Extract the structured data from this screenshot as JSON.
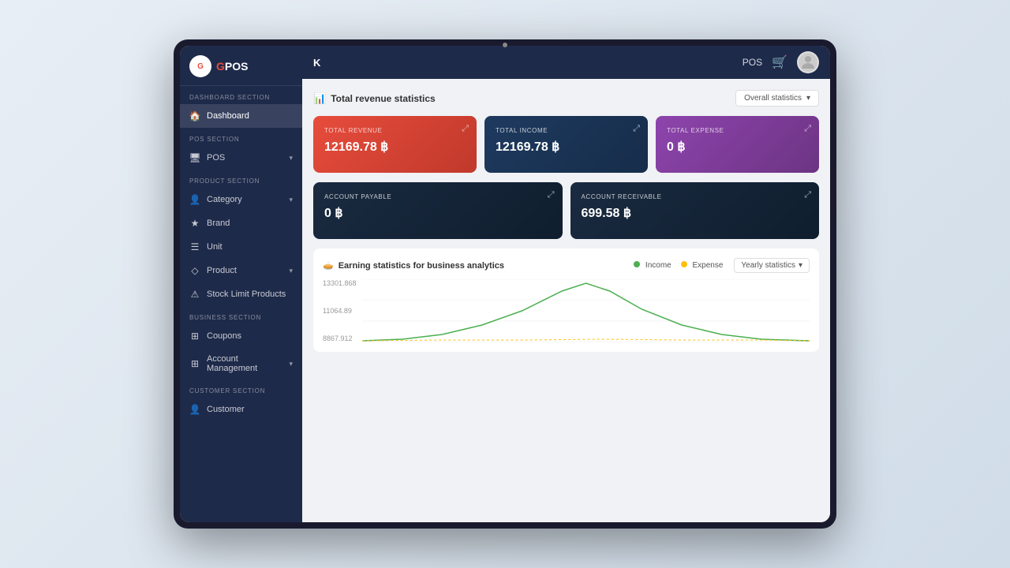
{
  "monitor": {
    "dot": ""
  },
  "sidebar": {
    "logo_text_prefix": "G",
    "logo_text_brand": "POS",
    "sections": [
      {
        "label": "DASHBOARD SECTION",
        "items": [
          {
            "id": "dashboard",
            "icon": "🏠",
            "label": "Dashboard",
            "active": true,
            "has_chevron": false
          }
        ]
      },
      {
        "label": "POS SECTION",
        "items": [
          {
            "id": "pos",
            "icon": "🖥",
            "label": "POS",
            "active": false,
            "has_chevron": true
          }
        ]
      },
      {
        "label": "PRODUCT SECTION",
        "items": [
          {
            "id": "category",
            "icon": "👤",
            "label": "Category",
            "active": false,
            "has_chevron": true
          },
          {
            "id": "brand",
            "icon": "★",
            "label": "Brand",
            "active": false,
            "has_chevron": false
          },
          {
            "id": "unit",
            "icon": "☰",
            "label": "Unit",
            "active": false,
            "has_chevron": false
          },
          {
            "id": "product",
            "icon": "◇",
            "label": "Product",
            "active": false,
            "has_chevron": true
          },
          {
            "id": "stock-limit",
            "icon": "⚠",
            "label": "Stock Limit Products",
            "active": false,
            "has_chevron": false
          }
        ]
      },
      {
        "label": "BUSINESS SECTION",
        "items": [
          {
            "id": "coupons",
            "icon": "⊞",
            "label": "Coupons",
            "active": false,
            "has_chevron": false
          },
          {
            "id": "account-management",
            "icon": "⊞",
            "label": "Account Management",
            "active": false,
            "has_chevron": true
          }
        ]
      },
      {
        "label": "CUSTOMER SECTION",
        "items": [
          {
            "id": "customer",
            "icon": "👤",
            "label": "Customer",
            "active": false,
            "has_chevron": false
          }
        ]
      }
    ]
  },
  "topbar": {
    "k_label": "K",
    "pos_label": "POS",
    "cart_icon": "🛒"
  },
  "main": {
    "stats_title": "Total revenue statistics",
    "stats_dropdown": "Overall statistics",
    "cards": [
      {
        "id": "total-revenue",
        "label": "TOTAL REVENUE",
        "value": "12169.78 ฿",
        "style": "red"
      },
      {
        "id": "total-income",
        "label": "TOTAL INCOME",
        "value": "12169.78 ฿",
        "style": "dark-blue"
      },
      {
        "id": "total-expense",
        "label": "TOTAL EXPENSE",
        "value": "0 ฿",
        "style": "purple"
      }
    ],
    "cards2": [
      {
        "id": "account-payable",
        "label": "ACCOUNT PAYABLE",
        "value": "0 ฿"
      },
      {
        "id": "account-receivable",
        "label": "ACCOUNT RECEIVABLE",
        "value": "699.58 ฿"
      }
    ],
    "chart": {
      "title": "Earning statistics for business analytics",
      "legend": [
        {
          "label": "Income",
          "color": "#4caf50"
        },
        {
          "label": "Expense",
          "color": "#ffc107"
        }
      ],
      "dropdown": "Yearly statistics",
      "y_labels": [
        "13301.868",
        "11064.89",
        "8867.912"
      ]
    }
  }
}
